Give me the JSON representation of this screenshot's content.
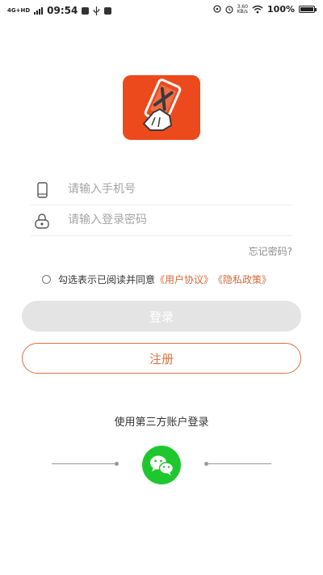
{
  "status_bar": {
    "network": "4G+HD",
    "time": "09:54",
    "speed_value": "3.60",
    "speed_unit": "KB/s",
    "battery": "100%"
  },
  "login": {
    "phone_placeholder": "请输入手机号",
    "password_placeholder": "请输入登录密码",
    "forgot_password": "忘记密码?",
    "agreement_prefix": "勾选表示已阅读并同意",
    "user_agreement": "《用户协议》",
    "privacy_policy": "《隐私政策》",
    "login_button": "登录",
    "register_button": "注册"
  },
  "third_party": {
    "title": "使用第三方账户登录",
    "wechat_icon": "wechat-icon"
  },
  "colors": {
    "brand_orange": "#ec4a1c",
    "link_orange": "#d4693a",
    "wechat_green": "#1fc72e",
    "disabled_button": "#e4e4e4"
  }
}
